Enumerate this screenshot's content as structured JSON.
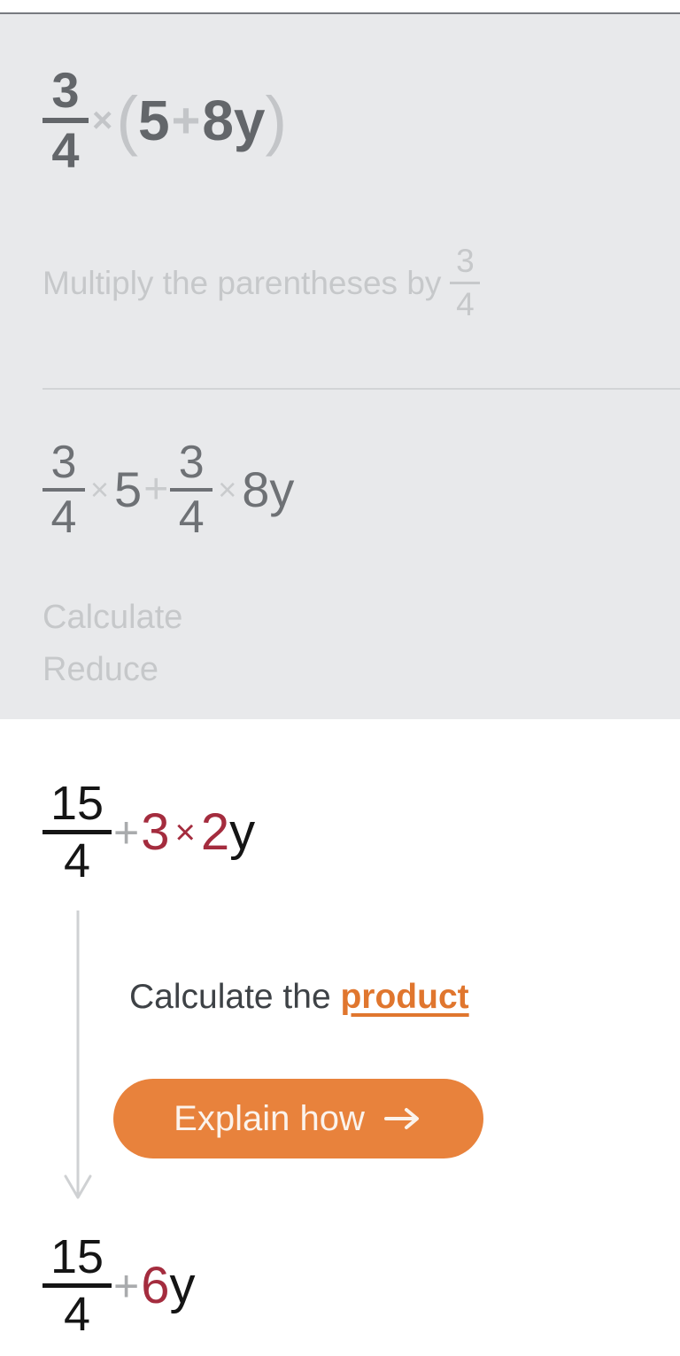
{
  "theme": {
    "faded_panel_bg": "#e8e9eb",
    "active_bg": "#ffffff",
    "faded_text": "#63666a",
    "faded_hint_text": "#c6c8ca",
    "active_text": "#151515",
    "highlight_crimson": "#A42C3E",
    "accent_orange": "#E8823C",
    "link_orange": "#E0762E",
    "operator_gray": "#c3c5c8",
    "divider": "#d2d4d6",
    "top_rule": "#777a80"
  },
  "faded_steps": [
    {
      "id": "step-distribute",
      "expression": {
        "fraction": {
          "numerator": "3",
          "denominator": "4"
        },
        "multiply_symbol": "×",
        "open_paren": "(",
        "inner_left": "5",
        "inner_plus": "+",
        "inner_right": "8",
        "inner_variable": "y",
        "close_paren": ")",
        "plain_text": "3/4 × (5 + 8y)"
      },
      "hint": {
        "text": "Multiply the parentheses by",
        "fraction": {
          "numerator": "3",
          "denominator": "4"
        },
        "plain_text": "Multiply the parentheses by 3/4"
      }
    },
    {
      "id": "step-expanded",
      "expression": {
        "first_fraction": {
          "numerator": "3",
          "denominator": "4"
        },
        "first_multiply": "×",
        "first_factor": "5",
        "plus": "+",
        "second_fraction": {
          "numerator": "3",
          "denominator": "4"
        },
        "second_multiply": "×",
        "second_factor": "8",
        "variable": "y",
        "plain_text": "3/4 × 5 + 3/4 × 8y"
      },
      "hints": [
        "Calculate",
        "Reduce"
      ]
    }
  ],
  "active_step": {
    "id": "step-product",
    "expression": {
      "fraction": {
        "numerator": "15",
        "denominator": "4"
      },
      "plus": "+",
      "highlight_left": "3",
      "highlight_multiply": "×",
      "highlight_right": "2",
      "variable": "y",
      "plain_text": "15/4 + 3 × 2y"
    },
    "instruction": {
      "prefix": "Calculate the",
      "keyword": "product",
      "plain_text": "Calculate the product"
    },
    "explain_button": {
      "label": "Explain how",
      "arrow": "→"
    },
    "result": {
      "fraction": {
        "numerator": "15",
        "denominator": "4"
      },
      "plus": "+",
      "highlight_coefficient": "6",
      "variable": "y",
      "plain_text": "15/4 + 6y"
    }
  }
}
